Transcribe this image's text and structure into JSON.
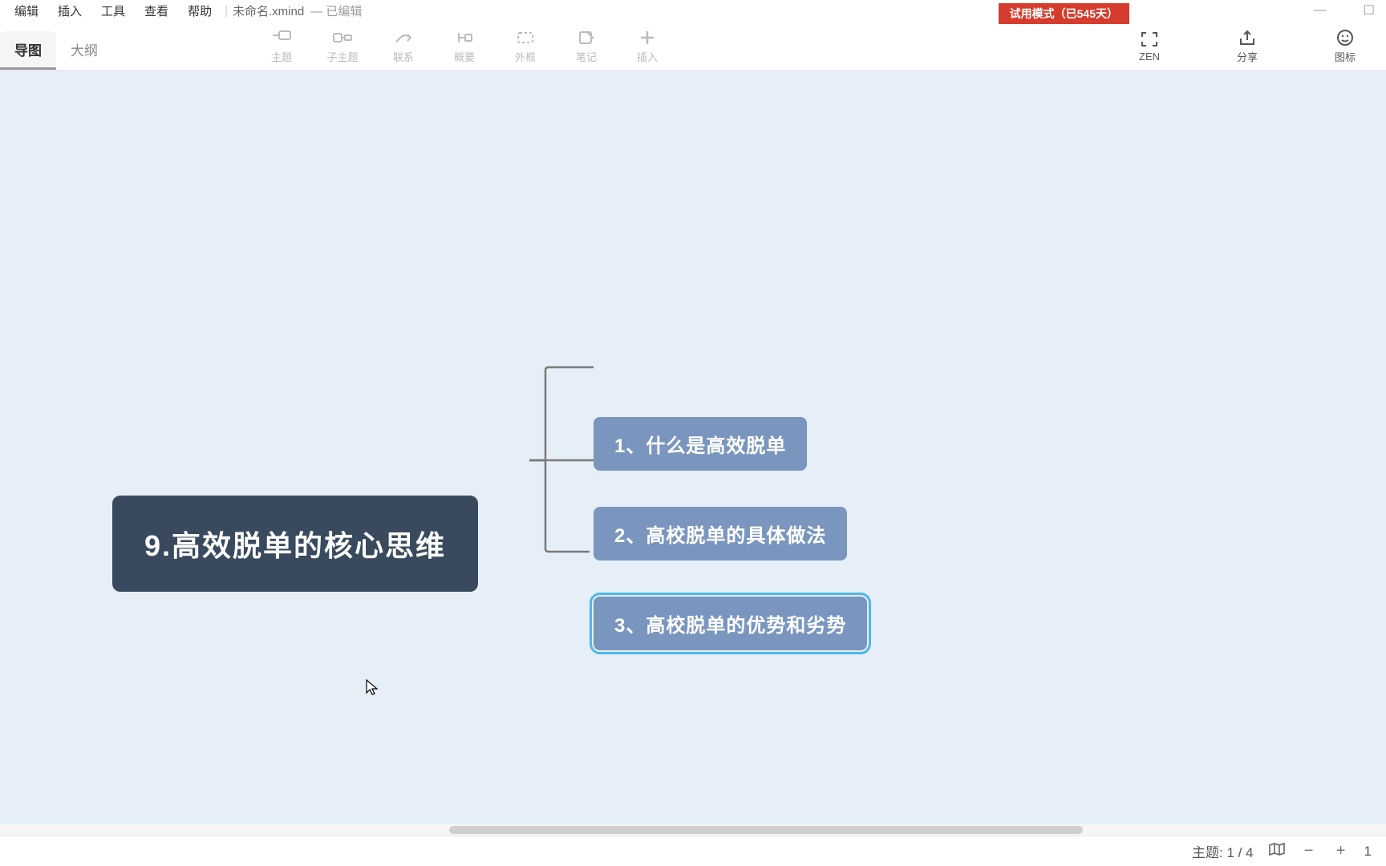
{
  "menubar": {
    "items": [
      "编辑",
      "插入",
      "工具",
      "查看",
      "帮助"
    ],
    "filename": "未命名.xmind",
    "edited": "— 已编辑"
  },
  "trial": "试用模式（已545天）",
  "viewTabs": {
    "map": "导图",
    "outline": "大纲"
  },
  "tools": {
    "topic": "主题",
    "subtopic": "子主题",
    "relation": "联系",
    "summary": "概要",
    "boundary": "外框",
    "note": "笔记",
    "insert": "插入",
    "zen": "ZEN",
    "share": "分享",
    "icon": "图标"
  },
  "mindmap": {
    "central": "9.高效脱单的核心思维",
    "children": [
      "1、什么是高效脱单",
      "2、高校脱单的具体做法",
      "3、高校脱单的优势和劣势"
    ],
    "selectedIndex": 2
  },
  "status": {
    "topicLabel": "主题:",
    "topicCount": "1 / 4",
    "zoom": "1"
  }
}
